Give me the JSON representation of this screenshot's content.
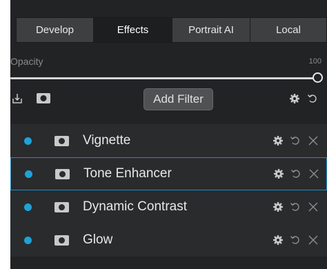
{
  "tabs": [
    {
      "label": "Develop",
      "active": false
    },
    {
      "label": "Effects",
      "active": true
    },
    {
      "label": "Portrait AI",
      "active": false
    },
    {
      "label": "Local",
      "active": false
    }
  ],
  "opacity": {
    "label": "Opacity",
    "value": "100",
    "level_percent": 100
  },
  "toolbar": {
    "add_filter_label": "Add Filter",
    "icons": [
      "export-icon",
      "mask-icon",
      "gear-icon",
      "reset-icon"
    ]
  },
  "filters": [
    {
      "name": "Vignette",
      "enabled": true,
      "selected": false
    },
    {
      "name": "Tone Enhancer",
      "enabled": true,
      "selected": true
    },
    {
      "name": "Dynamic Contrast",
      "enabled": true,
      "selected": false
    },
    {
      "name": "Glow",
      "enabled": true,
      "selected": false
    }
  ],
  "colors": {
    "accent": "#1ea2d8",
    "panel_bg": "#222325",
    "row_bg": "#2a2b2d",
    "selection_border": "#1a8fc7"
  }
}
